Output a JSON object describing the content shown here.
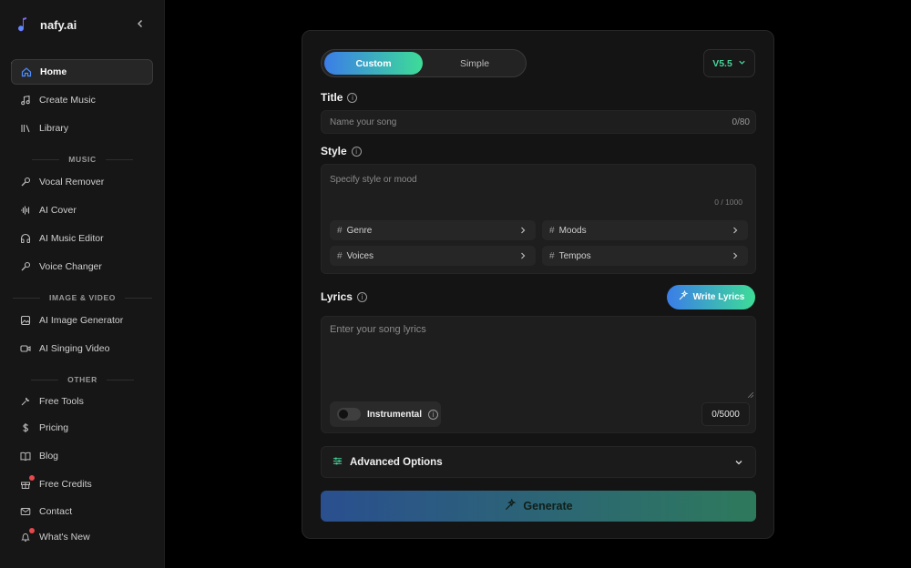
{
  "brand": {
    "name": "nafy.ai",
    "logo_icon": "music-note-icon"
  },
  "sidebar": {
    "items": [
      {
        "label": "Home",
        "icon": "home-icon",
        "active": true
      },
      {
        "label": "Create Music",
        "icon": "music-note-icon"
      },
      {
        "label": "Library",
        "icon": "library-icon"
      }
    ],
    "music_section": "MUSIC",
    "music_items": [
      {
        "label": "Vocal Remover",
        "icon": "microphone-icon"
      },
      {
        "label": "AI Cover",
        "icon": "waveform-icon"
      },
      {
        "label": "AI Music Editor",
        "icon": "headphones-icon"
      },
      {
        "label": "Voice Changer",
        "icon": "microphone-icon"
      }
    ],
    "image_section": "IMAGE & VIDEO",
    "image_items": [
      {
        "label": "AI Image Generator",
        "icon": "image-icon"
      },
      {
        "label": "AI Singing Video",
        "icon": "video-icon"
      }
    ],
    "other_section": "OTHER",
    "other_items": [
      {
        "label": "Free Tools",
        "icon": "wrench-icon"
      },
      {
        "label": "Pricing",
        "icon": "dollar-icon"
      },
      {
        "label": "Blog",
        "icon": "book-icon"
      },
      {
        "label": "Free Credits",
        "icon": "gift-icon",
        "badge": true
      },
      {
        "label": "Contact",
        "icon": "mail-icon"
      },
      {
        "label": "What's New",
        "icon": "bell-icon",
        "badge": true
      }
    ]
  },
  "form": {
    "mode_tabs": [
      "Custom",
      "Simple"
    ],
    "active_mode": "Custom",
    "version": "V5.5",
    "title": {
      "label": "Title",
      "placeholder": "Name your song",
      "counter": "0/80"
    },
    "style": {
      "label": "Style",
      "placeholder": "Specify style or mood",
      "counter": "0 / 1000",
      "chips": [
        "Genre",
        "Moods",
        "Voices",
        "Tempos"
      ]
    },
    "lyrics": {
      "label": "Lyrics",
      "write_button": "Write Lyrics",
      "placeholder": "Enter your song lyrics",
      "instrumental_label": "Instrumental",
      "counter": "0/5000"
    },
    "advanced_label": "Advanced Options",
    "generate_label": "Generate"
  },
  "colors": {
    "accent_blue": "#3b7de8",
    "accent_green": "#3ddc97",
    "version_green": "#46d39a",
    "badge_red": "#e5484d"
  }
}
